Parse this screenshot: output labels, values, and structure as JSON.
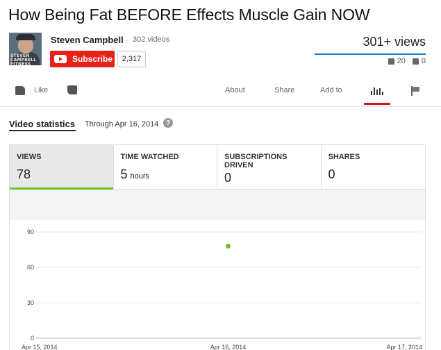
{
  "video": {
    "title": "How Being Fat BEFORE Effects Muscle Gain NOW"
  },
  "channel": {
    "name": "Steven Campbell",
    "separator": "·",
    "video_count": "302 videos",
    "avatar_text": "STEVEN CAMPBELL FITNESS",
    "subscribe_label": "Subscribe",
    "subscriber_count": "2,317"
  },
  "stats_summary": {
    "views": "301+ views",
    "likes": "20",
    "dislikes": "0"
  },
  "actions": {
    "like_label": "Like",
    "tabs": [
      "About",
      "Share",
      "Add to"
    ],
    "active_tab": "statistics"
  },
  "statistics": {
    "title": "Video statistics",
    "through": "Through Apr 16, 2014",
    "help": "?",
    "metrics": [
      {
        "label": "VIEWS",
        "value": "78",
        "unit": "",
        "active": true
      },
      {
        "label": "TIME WATCHED",
        "value": "5",
        "unit": "hours",
        "active": false
      },
      {
        "label": "SUBSCRIPTIONS DRIVEN",
        "value": "0",
        "unit": "",
        "active": false
      },
      {
        "label": "SHARES",
        "value": "0",
        "unit": "",
        "active": false
      }
    ]
  },
  "colors": {
    "subscribe": "#e62117",
    "views_bar": "#167ac6",
    "active_tab": "#cc181e",
    "metric_active": "#6fbf2b",
    "point": "#6fbf2b"
  },
  "chart_data": {
    "type": "scatter",
    "x": [
      "Apr 15, 2014",
      "Apr 16, 2014",
      "Apr 17, 2014"
    ],
    "series": [
      {
        "x": "Apr 16, 2014",
        "y": 78
      }
    ],
    "y_ticks": [
      0,
      30,
      60,
      90
    ],
    "ylim": [
      0,
      100
    ],
    "grid": true
  }
}
